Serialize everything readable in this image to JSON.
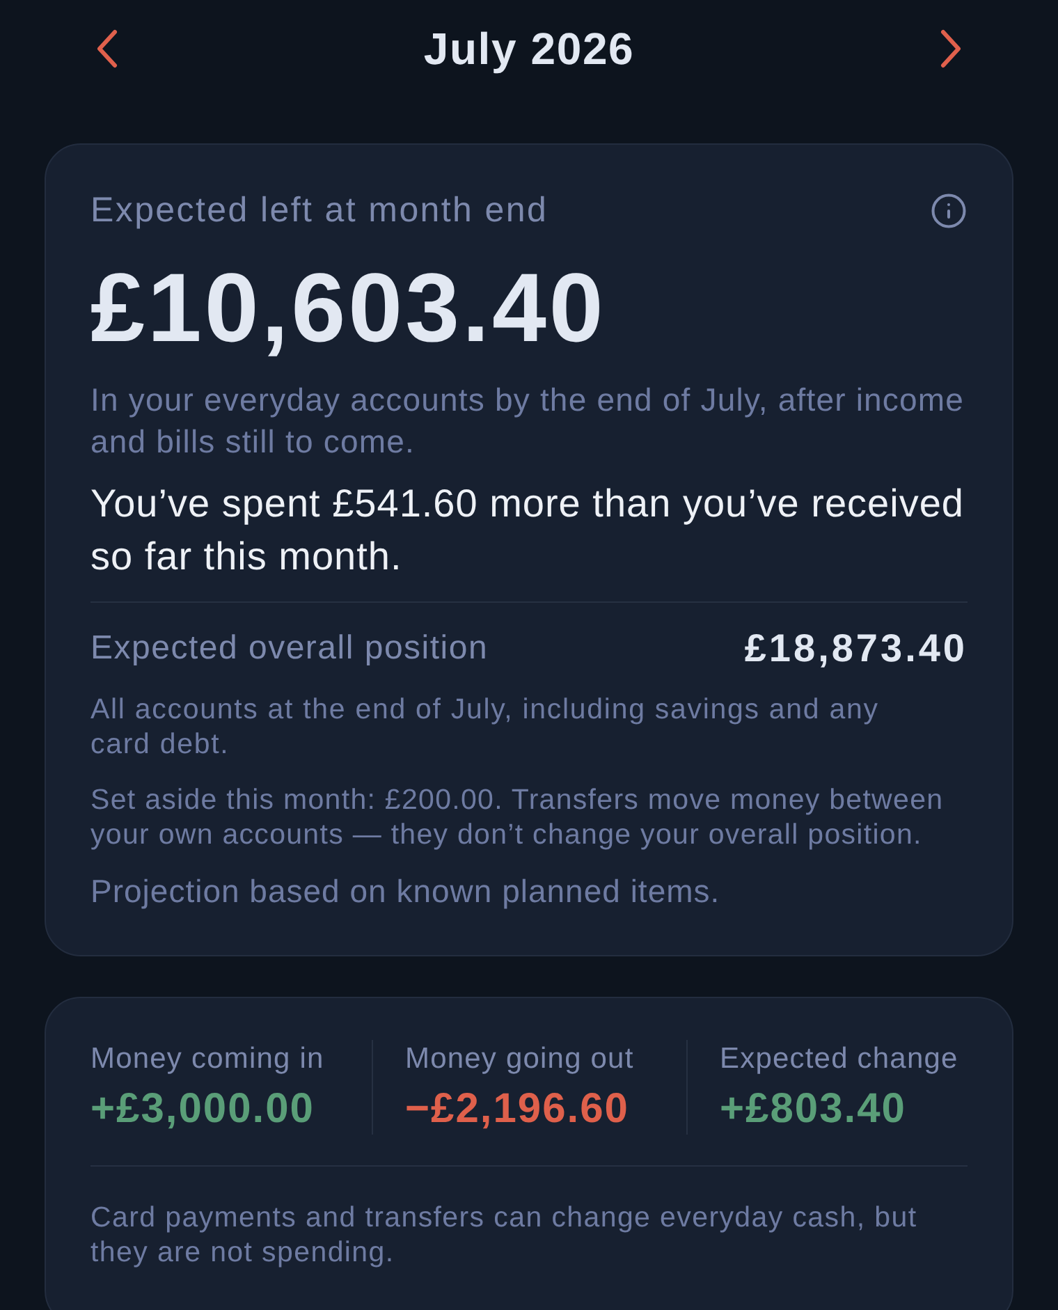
{
  "header": {
    "title": "July 2026"
  },
  "summary_card": {
    "label": "Expected left at month end",
    "amount": "£10,603.40",
    "description": "In your everyday accounts by the end of July, after income and bills still to come.",
    "spending_note": "You’ve spent £541.60 more than you’ve received so far this month.",
    "overall": {
      "label": "Expected overall position",
      "amount": "£18,873.40"
    },
    "overall_description": "All accounts at the end of July, including savings and any card debt.",
    "transfer_note": "Set aside this month: £200.00. Transfers move money between your own accounts — they don’t change your overall position.",
    "projection_note": "Projection based on known planned items."
  },
  "flow_card": {
    "columns": [
      {
        "label": "Money coming in",
        "value": "+£3,000.00",
        "color": "#5a9e78"
      },
      {
        "label": "Money going out",
        "value": "−£2,196.60",
        "color": "#df604b"
      },
      {
        "label": "Expected change",
        "value": "+£803.40",
        "color": "#5a9e78"
      }
    ],
    "footnote": "Card payments and transfers can change everyday cash, but they are not spending."
  }
}
